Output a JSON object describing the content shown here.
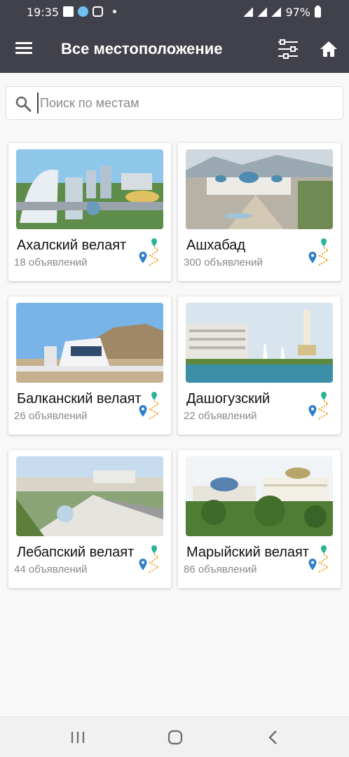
{
  "status_bar": {
    "time": "19:35",
    "battery": "97%"
  },
  "app_bar": {
    "title": "Все местоположение"
  },
  "search": {
    "placeholder": "Поиск по местам"
  },
  "cards": [
    {
      "title": "Ахалский велаят",
      "count": "18 объявлений",
      "image": "city-arch-image"
    },
    {
      "title": "Ашхабад",
      "count": "300 объявлений",
      "image": "capital-palace-image"
    },
    {
      "title": "Балканский велаят",
      "count": "26 объявлений",
      "image": "mountain-building-image"
    },
    {
      "title": "Дашогузский",
      "count": "22 объявлений",
      "image": "fountain-tower-image"
    },
    {
      "title": "Лебапский велаят",
      "count": "44 объявлений",
      "image": "boulevard-image"
    },
    {
      "title": "Марыйский велаят",
      "count": "86 объявлений",
      "image": "domed-palace-image"
    }
  ],
  "colors": {
    "app_bar": "#41414b",
    "pin_blue": "#2f7fc9",
    "pin_green": "#2bb39a",
    "route_orange": "#f0a22a"
  }
}
